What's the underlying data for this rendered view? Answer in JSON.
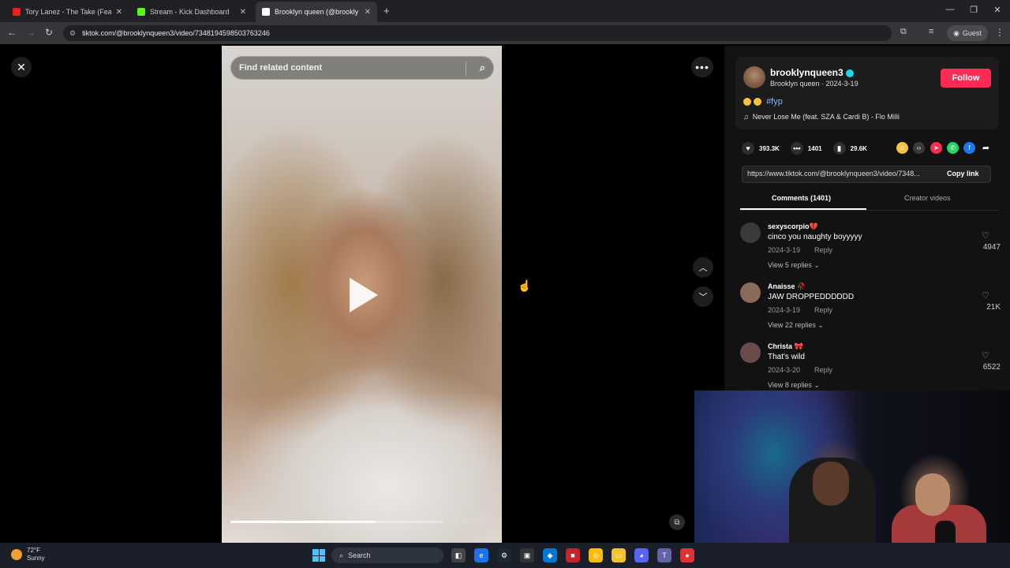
{
  "browser": {
    "tabs": [
      {
        "title": "Tory Lanez - The Take (Feat. Ch",
        "favicon_color": "#e62117",
        "icon": "youtube-icon"
      },
      {
        "title": "Stream - Kick Dashboard",
        "favicon_color": "#53fc18",
        "icon": "kick-icon"
      },
      {
        "title": "Brooklyn queen (@brookly",
        "favicon_color": "#ffffff",
        "icon": "tiktok-icon"
      }
    ],
    "url": "tiktok.com/@brooklynqueen3/video/7348194598503763246",
    "profile_label": "Guest"
  },
  "video": {
    "search_placeholder": "Find related content",
    "progress": 0.68,
    "timecode": "00:04/00:06"
  },
  "post": {
    "username": "brooklynqueen3",
    "display_line": "Brooklyn queen · 2024-3-19",
    "follow_label": "Follow",
    "hashtag": "#fyp",
    "music": "Never Lose Me (feat. SZA & Cardi B) - Flo Milli",
    "likes": "393.3K",
    "comments": "1401",
    "saves": "29.6K",
    "share_url": "https://www.tiktok.com/@brooklynqueen3/video/7348...",
    "copy_label": "Copy link",
    "tabs": {
      "comments": "Comments (1401)",
      "creator": "Creator videos"
    },
    "accent": "#fe2c55"
  },
  "comments": [
    {
      "user": "sexyscorpio💔",
      "text": "cinco you naughty boyyyyy",
      "date": "2024-3-19",
      "reply": "Reply",
      "view": "View 5 replies ⌄",
      "likes": "4947",
      "avatar_color": "#3a3a3a"
    },
    {
      "user": "Anaisse 🥀",
      "text": "JAW DROPPEDDDDDD",
      "date": "2024-3-19",
      "reply": "Reply",
      "view": "View 22 replies ⌄",
      "likes": "21K",
      "avatar_color": "#8a6a5a"
    },
    {
      "user": "Christa 🎀",
      "text": "That's wild",
      "date": "2024-3-20",
      "reply": "Reply",
      "view": "View 8 replies ⌄",
      "likes": "6522",
      "avatar_color": "#6a4a4a"
    }
  ],
  "taskbar": {
    "temperature": "72°F",
    "condition": "Sunny",
    "search_label": "Search"
  }
}
